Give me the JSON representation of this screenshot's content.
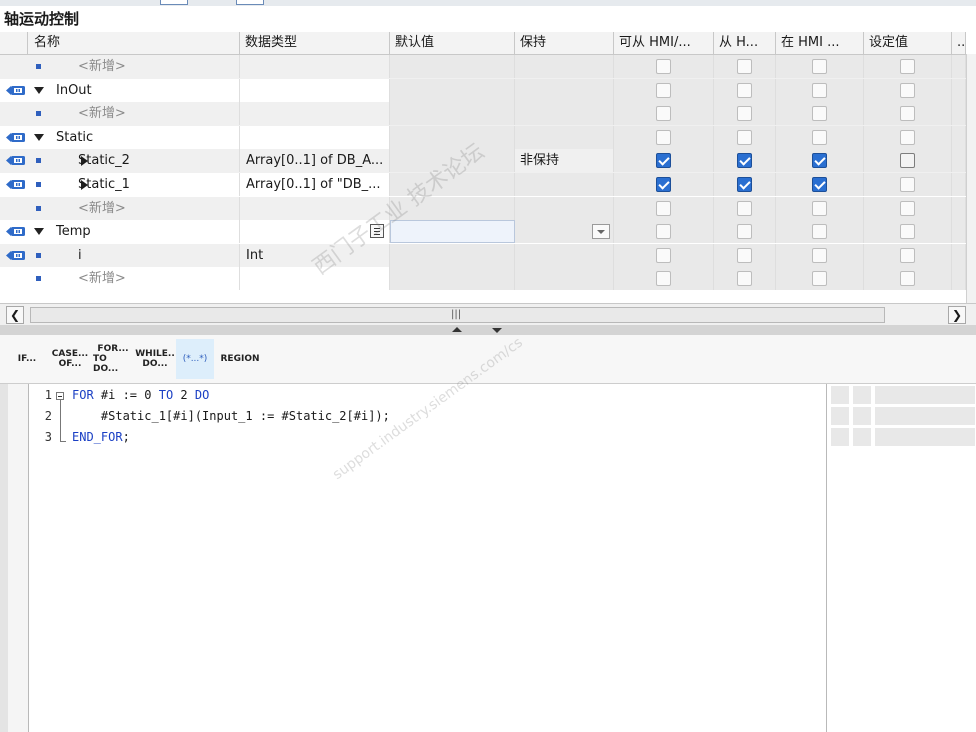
{
  "window": {
    "title": "轴运动控制"
  },
  "table": {
    "columns": [
      "名称",
      "数据类型",
      "默认值",
      "保持",
      "可从 HMI/...",
      "从 H...",
      "在 HMI ...",
      "设定值",
      "..."
    ],
    "rows": [
      {
        "name": "<新增>",
        "type": "",
        "retain": "",
        "kind": "placeholder",
        "level": 1,
        "checks": [
          "off",
          "off",
          "off",
          "off"
        ]
      },
      {
        "name": "InOut",
        "type": "",
        "retain": "",
        "kind": "section",
        "level": 0,
        "checks": [
          "off",
          "off",
          "off",
          "off"
        ]
      },
      {
        "name": "<新增>",
        "type": "",
        "retain": "",
        "kind": "placeholder",
        "level": 1,
        "checks": [
          "off",
          "off",
          "off",
          "off"
        ]
      },
      {
        "name": "Static",
        "type": "",
        "retain": "",
        "kind": "section",
        "level": 0,
        "checks": [
          "off",
          "off",
          "off",
          "off"
        ]
      },
      {
        "name": "Static_2",
        "type": "Array[0..1] of DB_A...",
        "retain": "非保持",
        "kind": "collapsed",
        "level": 1,
        "checks": [
          "on",
          "on",
          "on",
          "dark"
        ]
      },
      {
        "name": "Static_1",
        "type": "Array[0..1] of \"DB_...",
        "retain": "",
        "kind": "collapsed",
        "level": 1,
        "checks": [
          "on",
          "on",
          "on",
          "off"
        ]
      },
      {
        "name": "<新增>",
        "type": "",
        "retain": "",
        "kind": "placeholder",
        "level": 1,
        "checks": [
          "off",
          "off",
          "off",
          "off"
        ]
      },
      {
        "name": "Temp",
        "type": "",
        "retain": "",
        "kind": "section",
        "level": 0,
        "checks": [
          "off",
          "off",
          "off",
          "off"
        ]
      },
      {
        "name": "i",
        "type": "Int",
        "retain": "",
        "kind": "var",
        "level": 1,
        "checks": [
          "off",
          "off",
          "off",
          "off"
        ]
      },
      {
        "name": "<新增>",
        "type": "",
        "retain": "",
        "kind": "placeholder",
        "level": 1,
        "checks": [
          "off",
          "off",
          "off",
          "off"
        ]
      }
    ]
  },
  "scrollbar": {
    "center_glyph": "|||"
  },
  "toolbar": {
    "items": [
      {
        "id": "if",
        "line1": "IF...",
        "line2": ""
      },
      {
        "id": "case",
        "line1": "CASE...",
        "line2": "OF..."
      },
      {
        "id": "for",
        "line1": "FOR...",
        "line2": "TO DO..."
      },
      {
        "id": "while",
        "line1": "WHILE..",
        "line2": "DO..."
      },
      {
        "id": "comment",
        "line1": "(*...*)",
        "line2": ""
      },
      {
        "id": "region",
        "line1": "REGION",
        "line2": ""
      }
    ]
  },
  "code": {
    "lines": [
      {
        "n": "1",
        "kw1": "FOR",
        "mid": " #i := 0 ",
        "kw2": "TO",
        "mid2": " 2 ",
        "kw3": "DO",
        "rest": ""
      },
      {
        "n": "2",
        "kw1": "",
        "mid": "    #Static_1[#i](Input_1 := #Static_2[#i]);",
        "kw2": "",
        "mid2": "",
        "kw3": "",
        "rest": ""
      },
      {
        "n": "3",
        "kw1": "END_FOR",
        "mid": ";",
        "kw2": "",
        "mid2": "",
        "kw3": "",
        "rest": ""
      }
    ]
  },
  "watermark": {
    "text1": "西门子工业 技术论坛",
    "text2": "support.industry.siemens.com/cs"
  },
  "colors": {
    "accent": "#2a6fd1",
    "keyword": "#1a3fc4",
    "row_alt": "#f0f0f0"
  }
}
